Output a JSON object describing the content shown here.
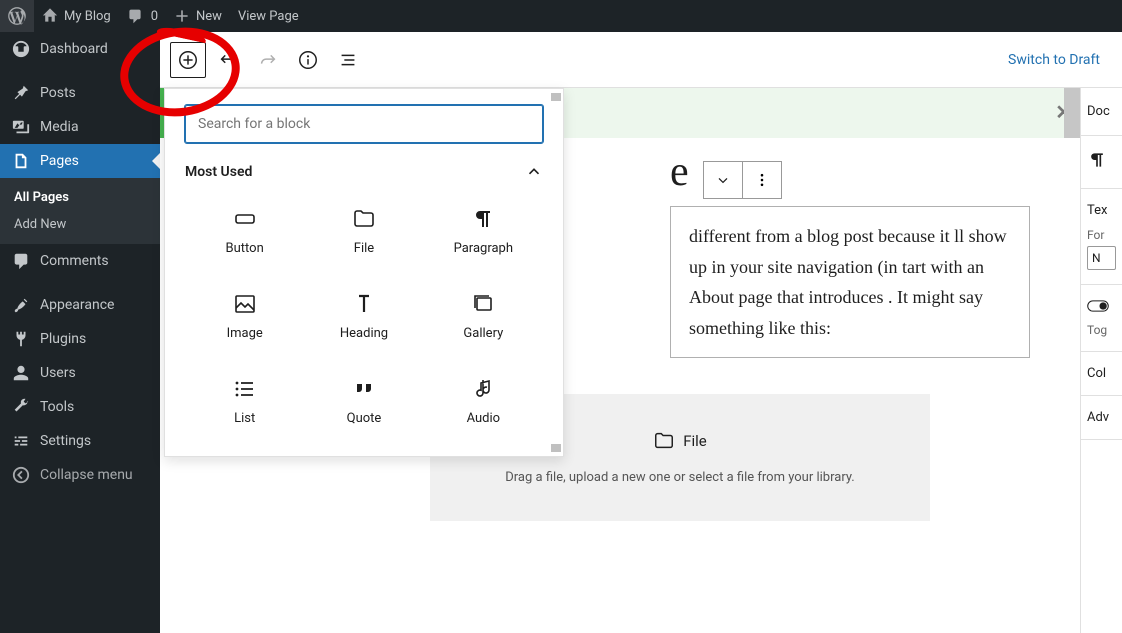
{
  "adminbar": {
    "site_name": "My Blog",
    "comments_count": "0",
    "new_label": "New",
    "view_page": "View Page"
  },
  "sidebar": {
    "dashboard": "Dashboard",
    "posts": "Posts",
    "media": "Media",
    "pages": "Pages",
    "pages_sub_all": "All Pages",
    "pages_sub_add": "Add New",
    "comments": "Comments",
    "appearance": "Appearance",
    "plugins": "Plugins",
    "users": "Users",
    "tools": "Tools",
    "settings": "Settings",
    "collapse": "Collapse menu"
  },
  "toolbar": {
    "switch_draft": "Switch to Draft"
  },
  "inserter": {
    "search_placeholder": "Search for a block",
    "section_title": "Most Used",
    "blocks": {
      "button": "Button",
      "file": "File",
      "paragraph": "Paragraph",
      "image": "Image",
      "heading": "Heading",
      "gallery": "Gallery",
      "list": "List",
      "quote": "Quote",
      "audio": "Audio"
    }
  },
  "content": {
    "title_visible": "e",
    "paragraph": "different from a blog post because it ll show up in your site navigation (in tart with an About page that introduces . It might say something like this:",
    "file_block_title": "File",
    "file_block_desc": "Drag a file, upload a new one or select a file from your library."
  },
  "right_panel": {
    "tab_doc": "Doc",
    "text": "Tex",
    "font": "For",
    "toggle": "Tog",
    "color": "Col",
    "advanced": "Adv"
  },
  "notice": {
    "close": "✕"
  }
}
